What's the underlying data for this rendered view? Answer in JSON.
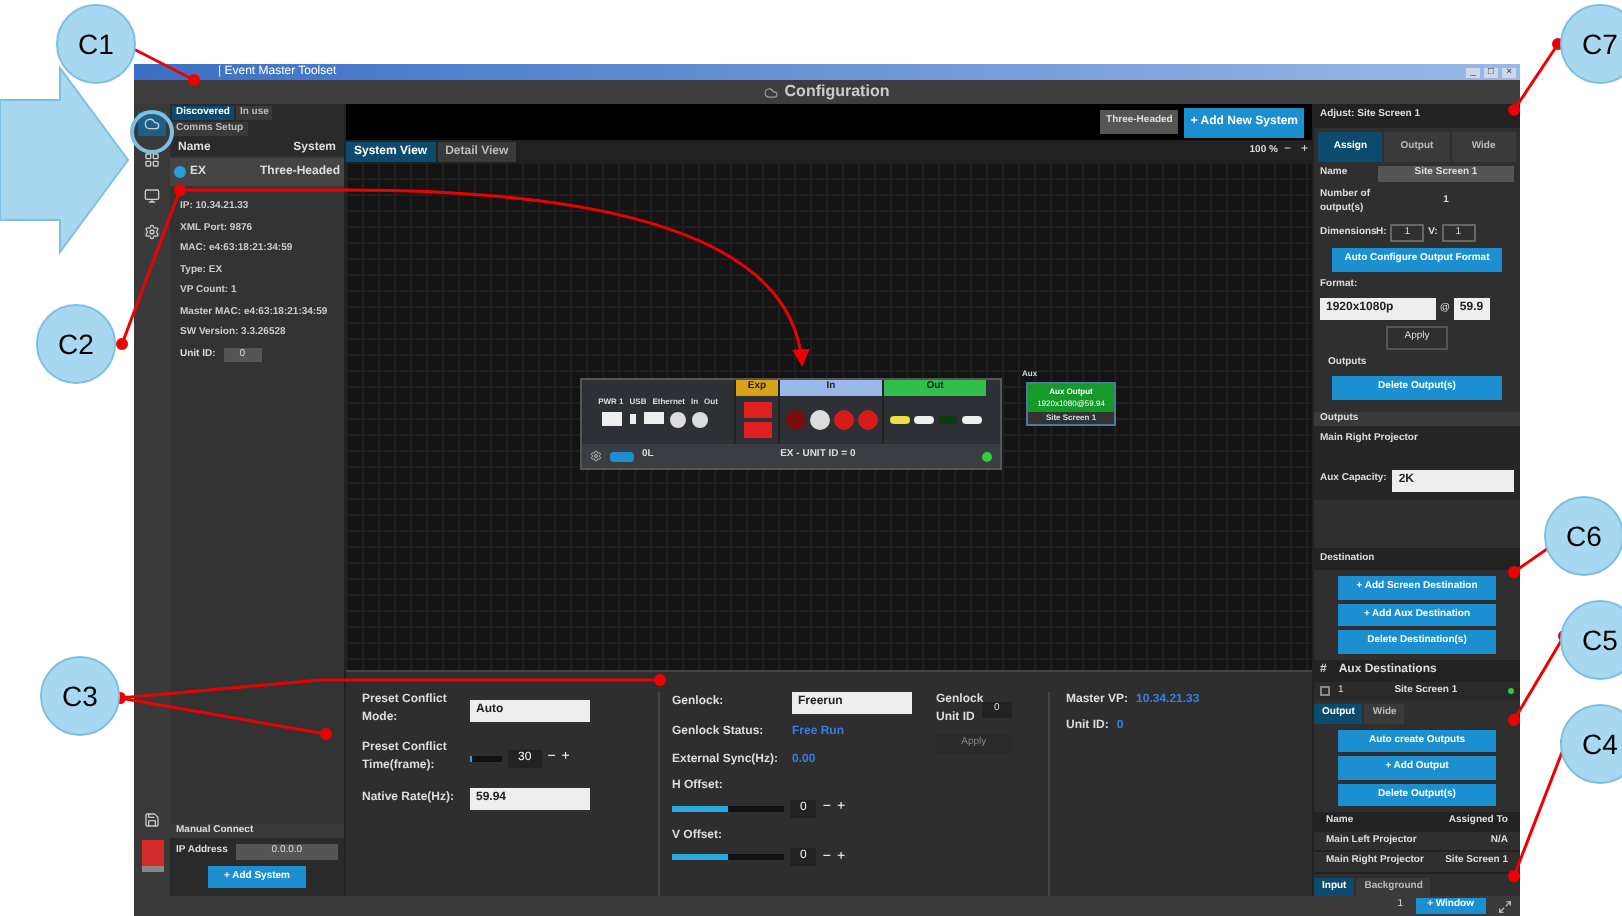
{
  "window": {
    "title": "| Event Master Toolset",
    "controls": [
      "_",
      "□",
      "×"
    ]
  },
  "header": {
    "title": "Configuration"
  },
  "rail": [
    {
      "kind": "cloud",
      "selected": true
    },
    {
      "kind": "grid",
      "selected": false
    },
    {
      "kind": "monitor",
      "selected": false
    },
    {
      "kind": "gear",
      "selected": false
    }
  ],
  "left": {
    "tabs": [
      {
        "label": "Discovered",
        "selected": true
      },
      {
        "label": "In use",
        "selected": false
      },
      {
        "label": "Comms Setup",
        "selected": false
      }
    ],
    "columns": [
      "Name",
      "System"
    ],
    "system": {
      "name": "EX",
      "group": "Three-Headed",
      "selected": true
    },
    "details": [
      "IP: 10.34.21.33",
      "XML Port: 9876",
      "MAC: e4:63:18:21:34:59",
      "Type: EX",
      "VP Count: 1",
      "Master MAC: e4:63:18:21:34:59",
      "SW Version: 3.3.26528"
    ],
    "unit_id": {
      "label": "Unit ID:",
      "value": "0"
    },
    "manual": {
      "title": "Manual Connect",
      "ip_label": "IP Address",
      "ip_value": "0.0.0.0",
      "button": "+ Add System"
    }
  },
  "center": {
    "system_select": "Three-Headed",
    "add_button": "+ Add New System",
    "view_tabs": [
      {
        "label": "System View",
        "selected": true
      },
      {
        "label": "Detail View",
        "selected": false
      }
    ],
    "zoom": "100 %",
    "zoom_out": "−",
    "zoom_in": "+",
    "device": {
      "ports": [
        "PWR 1",
        "USB",
        "Ethernet",
        "In",
        "Out"
      ],
      "sections": [
        {
          "label": "Exp",
          "color": "#d9a21b"
        },
        {
          "label": "In",
          "color": "#9ab8e8"
        },
        {
          "label": "Out",
          "color": "#2fbf4a"
        }
      ],
      "toggle_on": true,
      "footer_label": "0L",
      "title": "EX - UNIT ID = 0",
      "online": true
    },
    "aux": {
      "label": "Aux",
      "title": "Aux Output",
      "format": "1920x1080@59.94",
      "screen": "Site Screen 1"
    }
  },
  "bottom": {
    "preset_mode": {
      "label": "Preset Conflict Mode:",
      "value": "Auto"
    },
    "preset_time": {
      "label": "Preset Conflict Time(frame):",
      "level": 0.05,
      "value": "30",
      "minus": "−",
      "plus": "+"
    },
    "native_rate": {
      "label": "Native Rate(Hz):",
      "value": "59.94"
    },
    "genlock": {
      "label": "Genlock:",
      "value": "Freerun"
    },
    "genlock_unit": {
      "label": "Genlock Unit ID",
      "value": "0"
    },
    "genlock_status": {
      "label": "Genlock Status:",
      "value": "Free Run"
    },
    "external_sync": {
      "label": "External Sync(Hz):",
      "value": "0.00"
    },
    "apply": "Apply",
    "offsets": [
      {
        "label": "H Offset:",
        "level": 0.5,
        "value": "0",
        "minus": "−",
        "plus": "+"
      },
      {
        "label": "V Offset:",
        "level": 0.5,
        "value": "0",
        "minus": "−",
        "plus": "+"
      }
    ],
    "master_vp": {
      "label": "Master VP:",
      "value": "10.34.21.33"
    },
    "unit_id": {
      "label": "Unit ID:",
      "value": "0"
    }
  },
  "right": {
    "title": "Adjust: Site Screen 1",
    "tabs": [
      {
        "label": "Assign",
        "selected": true
      },
      {
        "label": "Output",
        "selected": false
      },
      {
        "label": "Wide",
        "selected": false
      }
    ],
    "name": {
      "label": "Name",
      "value": "Site Screen 1"
    },
    "outputs_count": {
      "label": "Number of output(s)",
      "value": "1"
    },
    "dimensions": {
      "label": "Dimensions",
      "h_label": "H:",
      "h": "1",
      "v_label": "V:",
      "v": "1"
    },
    "auto_configure": "Auto Configure Output Format",
    "format": {
      "label": "Format:",
      "value": "1920x1080p",
      "at": "@",
      "rate": "59.9"
    },
    "apply": "Apply",
    "outputs_label": "Outputs",
    "delete_outputs": "Delete Output(s)",
    "outputs_section": {
      "title": "Outputs",
      "item": "Main Right Projector",
      "capacity_label": "Aux Capacity:",
      "capacity": "2K"
    },
    "destination": {
      "title": "Destination",
      "buttons": [
        "+ Add Screen Destination",
        "+ Add Aux Destination",
        "Delete Destination(s)"
      ]
    },
    "aux_destinations": {
      "hash": "#",
      "title": "Aux Destinations",
      "rows": [
        {
          "index": "1",
          "name": "Site Screen 1",
          "active": true
        }
      ]
    },
    "output_tabs": [
      {
        "label": "Output",
        "selected": true
      },
      {
        "label": "Wide",
        "selected": false
      }
    ],
    "output_buttons": [
      "Auto create Outputs",
      "+ Add Output",
      "Delete Output(s)"
    ],
    "table": {
      "columns": [
        "Name",
        "Assigned To"
      ],
      "rows": [
        [
          "Main Left Projector",
          "N/A"
        ],
        [
          "Main Right Projector",
          "Site Screen 1"
        ]
      ]
    },
    "bottom_tabs": [
      {
        "label": "Input",
        "selected": true
      },
      {
        "label": "Background",
        "selected": false
      }
    ]
  },
  "status_bar": {
    "page": "1",
    "window_button": "+ Window"
  },
  "callouts": [
    {
      "label": "C1"
    },
    {
      "label": "C7"
    },
    {
      "label": "C2"
    },
    {
      "label": "C6"
    },
    {
      "label": "C5"
    },
    {
      "label": "C3"
    },
    {
      "label": "C4"
    }
  ]
}
